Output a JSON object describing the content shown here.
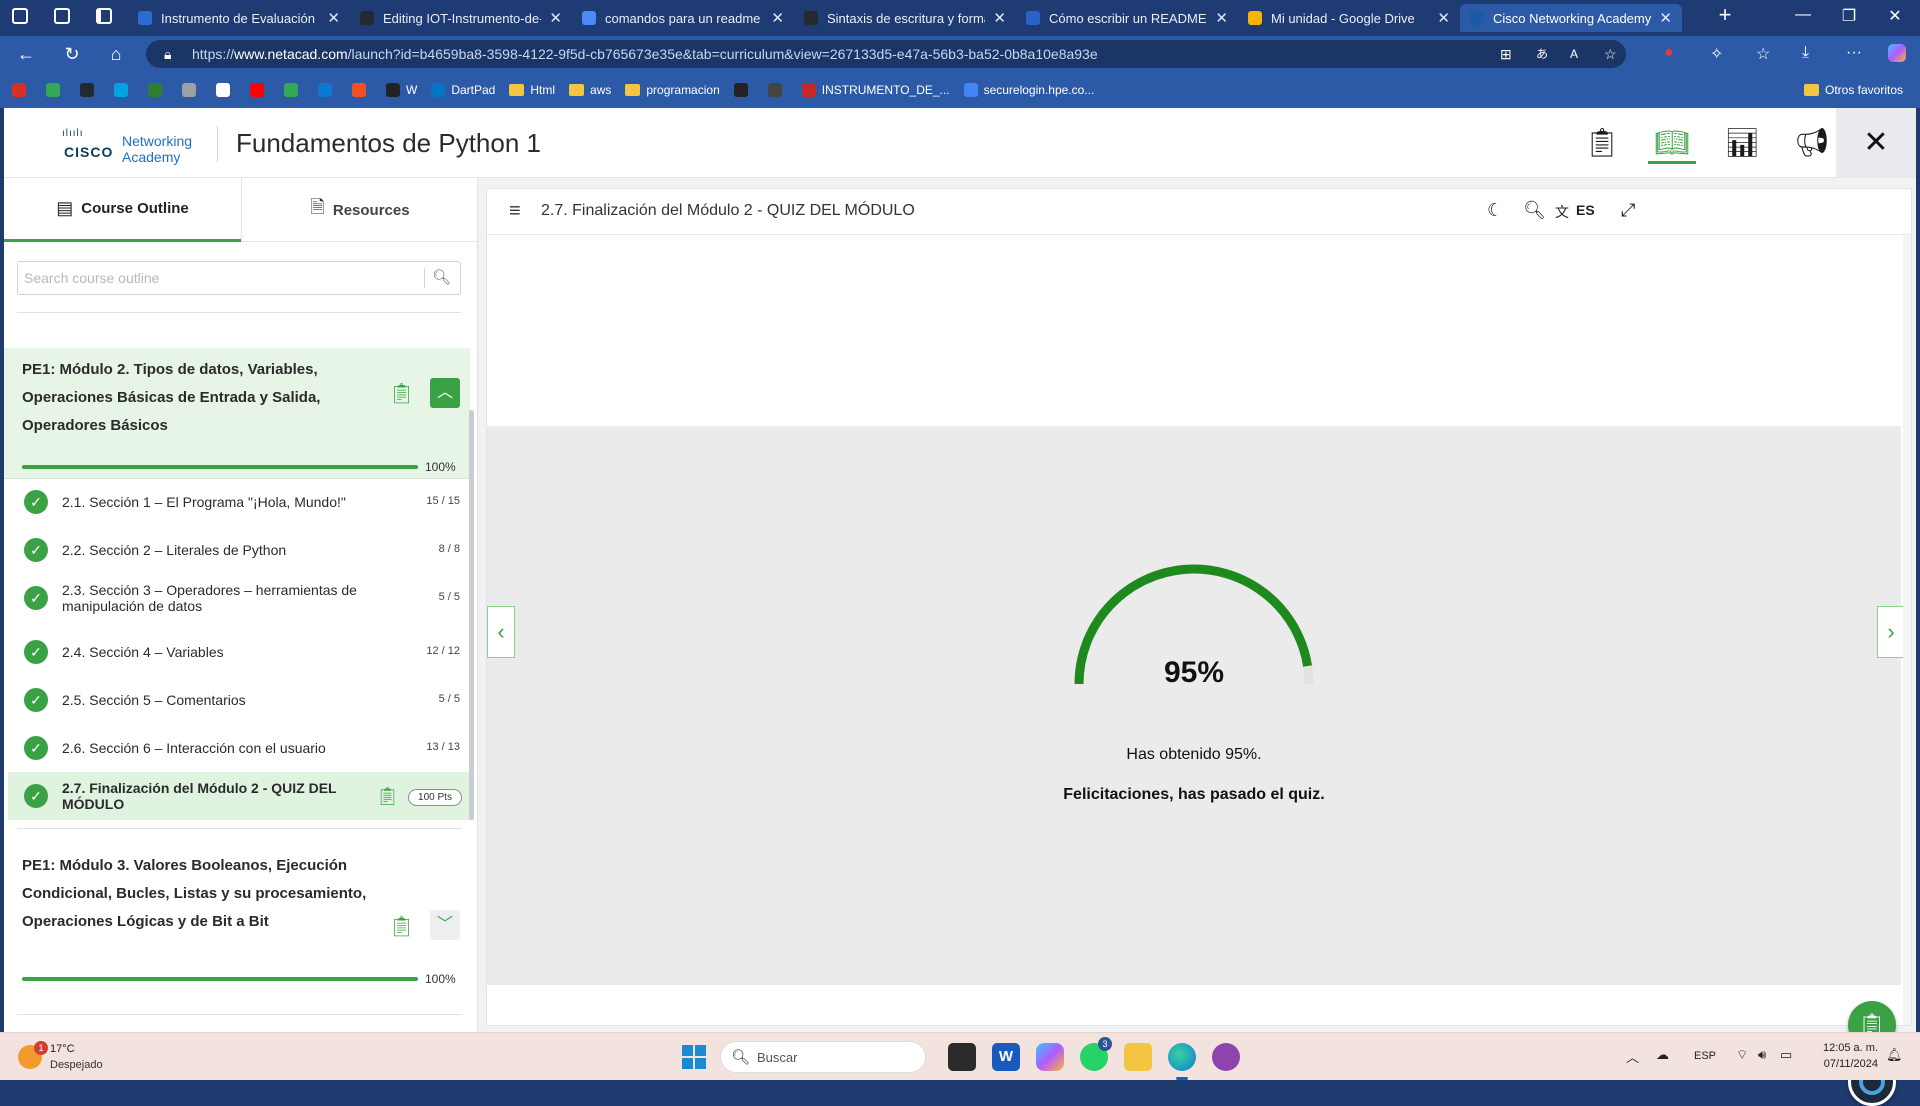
{
  "browser": {
    "tabs": [
      {
        "title": "Instrumento de Evaluación Uni",
        "color": "#2b6cd4"
      },
      {
        "title": "Editing IOT-Instrumento-de-Ev",
        "color": "#24292f"
      },
      {
        "title": "comandos para un readme en",
        "color": "#4c8bf5"
      },
      {
        "title": "Sintaxis de escritura y formato",
        "color": "#24292f"
      },
      {
        "title": "Cómo escribir un README inc",
        "color": "#2a62c9"
      },
      {
        "title": "Mi unidad - Google Drive",
        "color": "#f4b400"
      },
      {
        "title": "Cisco Networking Academy",
        "color": "#1b5aa6"
      }
    ],
    "new_tab": "+",
    "url_prefix": "https://",
    "url_domain": "www.netacad.com",
    "url_rest": "/launch?id=b4659ba8-3598-4122-9f5d-cb765673e35e&tab=curriculum&view=267133d5-e47a-56b3-ba52-0b8a10e8a93e",
    "bookmarks": [
      {
        "label": "",
        "color": "#d93025"
      },
      {
        "label": "",
        "color": "#34a853"
      },
      {
        "label": "",
        "color": "#24292f"
      },
      {
        "label": "",
        "color": "#00a3e0"
      },
      {
        "label": "",
        "color": "#2e7d32"
      },
      {
        "label": "",
        "color": "#9aa0a6"
      },
      {
        "label": "",
        "color": "#ffffff"
      },
      {
        "label": "",
        "color": "#ff0000"
      },
      {
        "label": "",
        "color": "#34a853"
      },
      {
        "label": "",
        "color": "#0b79d0"
      },
      {
        "label": "",
        "color": "#f25022"
      },
      {
        "label": "W",
        "color": "#222222"
      },
      {
        "label": "DartPad",
        "color": "#0175c2"
      },
      {
        "label": "Html",
        "color": "folder"
      },
      {
        "label": "aws",
        "color": "folder"
      },
      {
        "label": "programacion",
        "color": "folder"
      },
      {
        "label": "",
        "color": "#222222"
      },
      {
        "label": "",
        "color": "#444444"
      },
      {
        "label": "INSTRUMENTO_DE_...",
        "color": "#c62828"
      },
      {
        "label": "securelogin.hpe.co...",
        "color": "#4285f4"
      }
    ],
    "other_favorites": "Otros favoritos"
  },
  "app": {
    "logo_networking": "Networking",
    "logo_academy": "Academy",
    "logo_cisco": "CISCO",
    "title": "Fundamentos de Python 1"
  },
  "sidebar": {
    "tab_outline": "Course Outline",
    "tab_resources": "Resources",
    "search_placeholder": "Search course outline",
    "module2": {
      "title": "PE1: Módulo 2. Tipos de datos, Variables, Operaciones Básicas de Entrada y Salida, Operadores Básicos",
      "progress_label": "100%",
      "progress": 1.0
    },
    "items": [
      {
        "label": "2.1. Sección 1 – El Programa \"¡Hola, Mundo!\"",
        "count": "15 / 15"
      },
      {
        "label": "2.2. Sección 2 – Literales de Python",
        "count": "8 / 8"
      },
      {
        "label": "2.3. Sección 3 – Operadores – herramientas de manipulación de datos",
        "count": "5 / 5"
      },
      {
        "label": "2.4. Sección 4 – Variables",
        "count": "12 / 12"
      },
      {
        "label": "2.5. Sección 5 – Comentarios",
        "count": "5 / 5"
      },
      {
        "label": "2.6. Sección 6 – Interacción con el usuario",
        "count": "13 / 13"
      },
      {
        "label": "2.7. Finalización del Módulo 2 - QUIZ DEL MÓDULO",
        "count": "100 Pts"
      }
    ],
    "module3": {
      "title": "PE1: Módulo 3. Valores Booleanos, Ejecución Condicional, Bucles, Listas y su procesamiento, Operaciones Lógicas y de Bit a Bit",
      "progress_label": "100%",
      "progress": 1.0
    }
  },
  "content": {
    "title": "2.7. Finalización del Módulo 2 - QUIZ DEL MÓDULO",
    "lang": "ES",
    "score": 0.95,
    "score_label": "95%",
    "line1": "Has obtenido 95%.",
    "line2": "Felicitaciones, has pasado el quiz."
  },
  "taskbar": {
    "weather_temp": "17°C",
    "weather_desc": "Despejado",
    "weather_badge": "1",
    "search_placeholder": "Buscar",
    "whatsapp_badge": "3",
    "lang": "ESP",
    "time": "12:05 a. m.",
    "date": "07/11/2024"
  },
  "colors": {
    "accent": "#3aa244",
    "browser": "#2d5aa6"
  }
}
